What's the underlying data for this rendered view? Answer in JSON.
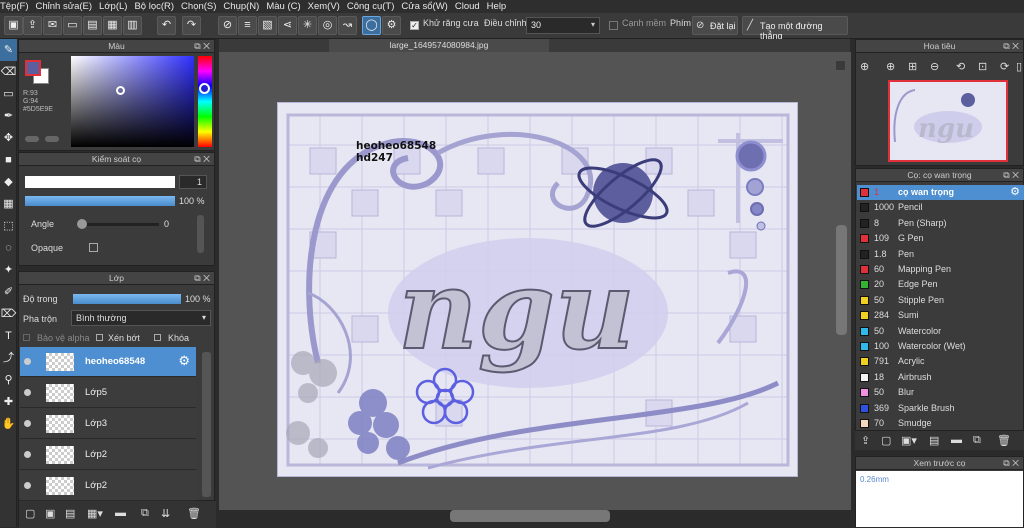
{
  "menu": [
    "Tệp(F)",
    "Chỉnh sửa(E)",
    "Lớp(L)",
    "Bộ lọc(R)",
    "Chọn(S)",
    "Chụp(N)",
    "Màu (C)",
    "Xem(V)",
    "Công cụ(T)",
    "Cửa sổ(W)",
    "Cloud",
    "Help"
  ],
  "toolbar": {
    "antialias_label": "Khử răng cưa",
    "adjust_label": "Điều chỉnh",
    "adjust_value": "30",
    "smooth_label": "Cạnh mềm",
    "key_label": "Phím",
    "reset_label": "Đặt lại",
    "create_line_label": "Tạo một đường thẳng"
  },
  "color_panel": {
    "title": "Màu",
    "r": "R:93",
    "g": "G:94",
    "hex": "#5D5E9E",
    "fg_color": "#5d5e9e"
  },
  "brush_control": {
    "title": "Kiểm soát cọ",
    "size_value": "1",
    "opacity_value": "100 %",
    "angle_label": "Angle",
    "angle_value": "0",
    "opaque_label": "Opaque"
  },
  "layers_panel": {
    "title": "Lớp",
    "opacity_label": "Độ trong",
    "opacity_value": "100 %",
    "blend_label": "Pha trộn",
    "blend_value": "Bình thường",
    "protect_alpha": "Bảo vệ alpha",
    "clipping": "Xén bớt",
    "lock": "Khóa",
    "layers": [
      {
        "name": "heoheo68548",
        "selected": true
      },
      {
        "name": "Lớp5",
        "selected": false
      },
      {
        "name": "Lớp3",
        "selected": false
      },
      {
        "name": "Lớp2",
        "selected": false
      },
      {
        "name": "Lớp2",
        "selected": false
      }
    ]
  },
  "canvas": {
    "tab_title": "large_1649574080984.jpg",
    "signature_line1": "heoheo68548",
    "signature_line2": "hd247",
    "big_word": "ngu"
  },
  "navigator": {
    "title": "Hoa tiêu"
  },
  "brush_panel": {
    "title": "Cọ: cọ wan trọng",
    "brushes": [
      {
        "size": "1",
        "name": "cọ wan trọng",
        "color": "#e0303a",
        "selected": true
      },
      {
        "size": "1000",
        "name": "Pencil",
        "color": "#222222",
        "selected": false
      },
      {
        "size": "8",
        "name": "Pen (Sharp)",
        "color": "#222222",
        "selected": false
      },
      {
        "size": "109",
        "name": "G Pen",
        "color": "#e0303a",
        "selected": false
      },
      {
        "size": "1.8",
        "name": "Pen",
        "color": "#222222",
        "selected": false
      },
      {
        "size": "60",
        "name": "Mapping Pen",
        "color": "#e0303a",
        "selected": false
      },
      {
        "size": "20",
        "name": "Edge Pen",
        "color": "#33b233",
        "selected": false
      },
      {
        "size": "50",
        "name": "Stipple Pen",
        "color": "#f0d020",
        "selected": false
      },
      {
        "size": "284",
        "name": "Sumi",
        "color": "#f0d020",
        "selected": false
      },
      {
        "size": "50",
        "name": "Watercolor",
        "color": "#30b8e8",
        "selected": false
      },
      {
        "size": "100",
        "name": "Watercolor (Wet)",
        "color": "#30b8e8",
        "selected": false
      },
      {
        "size": "791",
        "name": "Acrylic",
        "color": "#f0d020",
        "selected": false
      },
      {
        "size": "18",
        "name": "Airbrush",
        "color": "#f4f4f4",
        "selected": false
      },
      {
        "size": "50",
        "name": "Blur",
        "color": "#f090e0",
        "selected": false
      },
      {
        "size": "369",
        "name": "Sparkle Brush",
        "color": "#3050e0",
        "selected": false
      },
      {
        "size": "70",
        "name": "Smudge",
        "color": "#f4d8c0",
        "selected": false
      }
    ]
  },
  "preview_panel": {
    "title": "Xem trước cọ",
    "size_text": "0.26mm"
  }
}
